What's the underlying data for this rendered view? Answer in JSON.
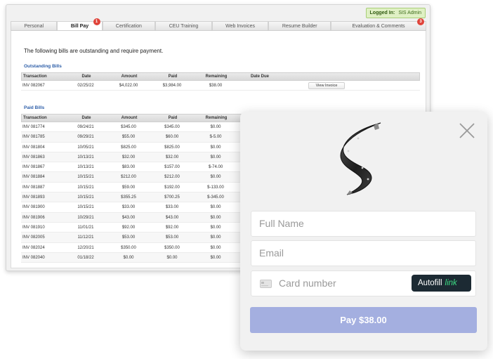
{
  "header": {
    "logged_label": "Logged In:",
    "user": "SIS Admin"
  },
  "tabs": [
    {
      "label": "Personal"
    },
    {
      "label": "Bill Pay",
      "badge": "1"
    },
    {
      "label": "Certification"
    },
    {
      "label": "CEU Training"
    },
    {
      "label": "Web Invoices"
    },
    {
      "label": "Resume Builder"
    },
    {
      "label": "Evaluation & Comments",
      "badge": "3"
    }
  ],
  "intro": "The following bills are outstanding and require payment.",
  "outstanding": {
    "title": "Outstanding Bills",
    "headers": [
      "Transaction",
      "Date",
      "Amount",
      "Paid",
      "Remaining",
      "Date Due"
    ],
    "rows": [
      [
        "INV 082067",
        "02/25/22",
        "$4,022.00",
        "$3,984.00",
        "$38.00",
        ""
      ]
    ],
    "action_label": "View Invoice"
  },
  "paid": {
    "title": "Paid Bills",
    "headers": [
      "Transaction",
      "Date",
      "Amount",
      "Paid",
      "Remaining"
    ],
    "rows": [
      [
        "INV 081774",
        "09/24/21",
        "$345.00",
        "$345.00",
        "$0.00"
      ],
      [
        "INV 081785",
        "09/29/21",
        "$55.00",
        "$60.00",
        "$-5.00"
      ],
      [
        "INV 081804",
        "10/05/21",
        "$825.00",
        "$825.00",
        "$0.00"
      ],
      [
        "INV 081863",
        "10/13/21",
        "$32.00",
        "$32.00",
        "$0.00"
      ],
      [
        "INV 081867",
        "10/13/21",
        "$83.00",
        "$157.00",
        "$-74.00"
      ],
      [
        "INV 081884",
        "10/15/21",
        "$212.00",
        "$212.00",
        "$0.00"
      ],
      [
        "INV 081887",
        "10/15/21",
        "$59.00",
        "$192.00",
        "$-133.00"
      ],
      [
        "INV 081893",
        "10/15/21",
        "$355.25",
        "$700.25",
        "$-345.00"
      ],
      [
        "INV 081900",
        "10/15/21",
        "$33.00",
        "$33.00",
        "$0.00"
      ],
      [
        "INV 081906",
        "10/29/21",
        "$43.00",
        "$43.00",
        "$0.00"
      ],
      [
        "INV 081910",
        "11/01/21",
        "$92.00",
        "$92.00",
        "$0.00"
      ],
      [
        "INV 082005",
        "11/12/21",
        "$53.00",
        "$53.00",
        "$0.00"
      ],
      [
        "INV 082024",
        "12/20/21",
        "$350.00",
        "$350.00",
        "$0.00"
      ],
      [
        "INV 082040",
        "01/18/22",
        "$0.00",
        "$0.00",
        "$0.00"
      ]
    ]
  },
  "modal": {
    "full_name_placeholder": "Full Name",
    "email_placeholder": "Email",
    "card_placeholder": "Card number",
    "autofill_label": "Autofill",
    "autofill_brand": "link",
    "pay_label": "Pay $38.00",
    "icons": {
      "close": "close-icon",
      "logo": "s-logo-icon",
      "card": "credit-card-icon"
    },
    "colors": {
      "pay_button": "#a4afe0",
      "autofill_bg": "#1c2a33",
      "link_green": "#3ddc84"
    }
  }
}
